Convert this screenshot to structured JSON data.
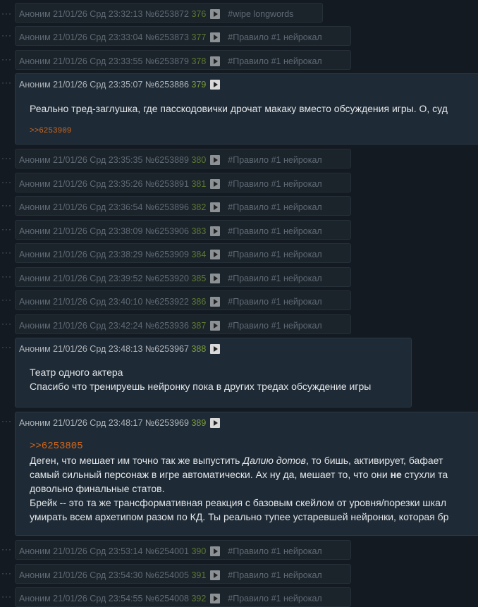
{
  "posts": [
    {
      "name": "Аноним",
      "date": "21/01/26 Срд 23:32:13",
      "id": "№6253872",
      "n": "376",
      "tag": "#wipe longwords"
    },
    {
      "name": "Аноним",
      "date": "21/01/26 Срд 23:33:04",
      "id": "№6253873",
      "n": "377",
      "tag": "#Правило #1 нейрокал"
    },
    {
      "name": "Аноним",
      "date": "21/01/26 Срд 23:33:55",
      "id": "№6253879",
      "n": "378",
      "tag": "#Правило #1 нейрокал"
    },
    {
      "name": "Аноним",
      "date": "21/01/26 Срд 23:35:07",
      "id": "№6253886",
      "n": "379",
      "text": "Реально тред-заглушка, где пасскодовички дрочат макаку вместо обсуждения игры. О, суд",
      "reply": ">>6253909"
    },
    {
      "name": "Аноним",
      "date": "21/01/26 Срд 23:35:35",
      "id": "№6253889",
      "n": "380",
      "tag": "#Правило #1 нейрокал"
    },
    {
      "name": "Аноним",
      "date": "21/01/26 Срд 23:35:26",
      "id": "№6253891",
      "n": "381",
      "tag": "#Правило #1 нейрокал"
    },
    {
      "name": "Аноним",
      "date": "21/01/26 Срд 23:36:54",
      "id": "№6253896",
      "n": "382",
      "tag": "#Правило #1 нейрокал"
    },
    {
      "name": "Аноним",
      "date": "21/01/26 Срд 23:38:09",
      "id": "№6253906",
      "n": "383",
      "tag": "#Правило #1 нейрокал"
    },
    {
      "name": "Аноним",
      "date": "21/01/26 Срд 23:38:29",
      "id": "№6253909",
      "n": "384",
      "tag": "#Правило #1 нейрокал"
    },
    {
      "name": "Аноним",
      "date": "21/01/26 Срд 23:39:52",
      "id": "№6253920",
      "n": "385",
      "tag": "#Правило #1 нейрокал"
    },
    {
      "name": "Аноним",
      "date": "21/01/26 Срд 23:40:10",
      "id": "№6253922",
      "n": "386",
      "tag": "#Правило #1 нейрокал"
    },
    {
      "name": "Аноним",
      "date": "21/01/26 Срд 23:42:24",
      "id": "№6253936",
      "n": "387",
      "tag": "#Правило #1 нейрокал"
    },
    {
      "name": "Аноним",
      "date": "21/01/26 Срд 23:48:13",
      "id": "№6253967",
      "n": "388",
      "lines": [
        "Театр одного актера",
        "Спасибо что тренируешь нейронку пока в других тредах обсуждение игры"
      ]
    },
    {
      "name": "Аноним",
      "date": "21/01/26 Срд 23:48:17",
      "id": "№6253969",
      "n": "389",
      "reply": ">>6253805",
      "l1a": "Деген, что мешает им точно так же выпустить ",
      "l1em": "Далию дотов",
      "l1b": ", то бишь, активирует, бафает",
      "l2a": "самый сильный персонаж в игре автоматически. Ах ну да, мешает то, что они ",
      "l2b": "не",
      "l2c": " стухли та",
      "l3": "довольно финальные статов.",
      "l4": "Брейк -- это та же трансформативная реакция с базовым скейлом от уровня/порезки шкал",
      "l5": "умирать всем архетипом разом по КД. Ты реально тупее устаревшей нейронки, которая бр"
    },
    {
      "name": "Аноним",
      "date": "21/01/26 Срд 23:53:14",
      "id": "№6254001",
      "n": "390",
      "tag": "#Правило #1 нейрокал"
    },
    {
      "name": "Аноним",
      "date": "21/01/26 Срд 23:54:30",
      "id": "№6254005",
      "n": "391",
      "tag": "#Правило #1 нейрокал"
    },
    {
      "name": "Аноним",
      "date": "21/01/26 Срд 23:54:55",
      "id": "№6254008",
      "n": "392",
      "tag": "#Правило #1 нейрокал"
    }
  ]
}
